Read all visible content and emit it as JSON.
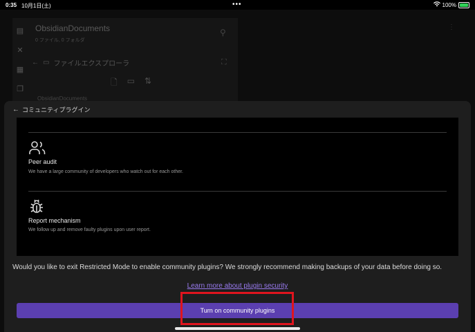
{
  "status_bar": {
    "time": "0:35",
    "date": "10月1日(土)",
    "dots": "•••",
    "battery_percent": "100%"
  },
  "background": {
    "vault_title": "ObsidianDocuments",
    "vault_subtitle": "0 ファイル, 0 フォルダ",
    "explorer_label": "ファイルエクスプローラ",
    "vault_name_partial": "ObsidianDocuments"
  },
  "modal": {
    "back_label": "コミュニティプラグイン",
    "features": [
      {
        "icon": "users-icon",
        "title": "Peer audit",
        "description": "We have a large community of developers who watch out for each other."
      },
      {
        "icon": "bug-icon",
        "title": "Report mechanism",
        "description": "We follow up and remove faulty plugins upon user report."
      }
    ],
    "question": "Would you like to exit Restricted Mode to enable community plugins? We strongly recommend making backups of your data before doing so.",
    "learn_more_link": "Learn more about plugin security",
    "turn_on_button": "Turn on community plugins"
  },
  "colors": {
    "accent": "#5b3fb0",
    "link": "#9a7bf0",
    "highlight_box": "#e0141e"
  }
}
